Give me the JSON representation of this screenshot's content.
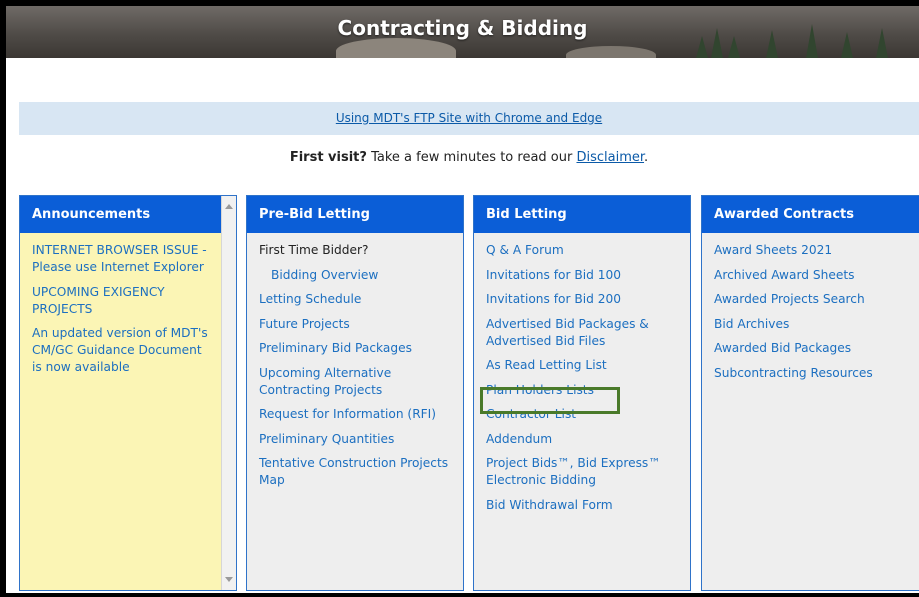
{
  "banner": {
    "title": "Contracting & Bidding"
  },
  "notice": {
    "link": "Using MDT's FTP Site with Chrome and Edge"
  },
  "first_visit": {
    "bold": "First visit?",
    "text": " Take a few minutes to read our ",
    "link": "Disclaimer",
    "end": "."
  },
  "columns": {
    "announcements": {
      "title": "Announcements",
      "items": [
        "INTERNET BROWSER ISSUE - Please use Internet Explorer",
        "UPCOMING EXIGENCY PROJECTS",
        "An updated version of MDT's CM/GC Guidance Document is now available"
      ]
    },
    "pre_bid": {
      "title": "Pre-Bid Letting",
      "items": [
        "First Time Bidder?",
        "Bidding Overview",
        "Letting Schedule",
        "Future Projects",
        "Preliminary Bid Packages",
        "Upcoming Alternative Contracting Projects",
        "Request for Information (RFI)",
        "Preliminary Quantities",
        "Tentative Construction Projects Map"
      ]
    },
    "bid": {
      "title": "Bid Letting",
      "items": [
        "Q & A Forum",
        "Invitations for Bid 100",
        "Invitations for Bid 200",
        "Advertised Bid Packages & Advertised Bid Files",
        "As Read Letting List",
        "Plan Holders Lists",
        "Contractor List",
        "Addendum",
        "Project Bids™, Bid Express™ Electronic Bidding",
        "Bid Withdrawal Form"
      ]
    },
    "awarded": {
      "title": "Awarded Contracts",
      "items": [
        "Award Sheets 2021",
        "Archived Award Sheets",
        "Awarded Projects Search",
        "Bid Archives",
        "Awarded Bid Packages",
        "Subcontracting Resources"
      ]
    }
  },
  "colors": {
    "header_blue": "#0b5ed7",
    "link_blue": "#1c6fc0",
    "announcement_bg": "#fbf5b5",
    "highlight_green": "#4a7a2a"
  }
}
